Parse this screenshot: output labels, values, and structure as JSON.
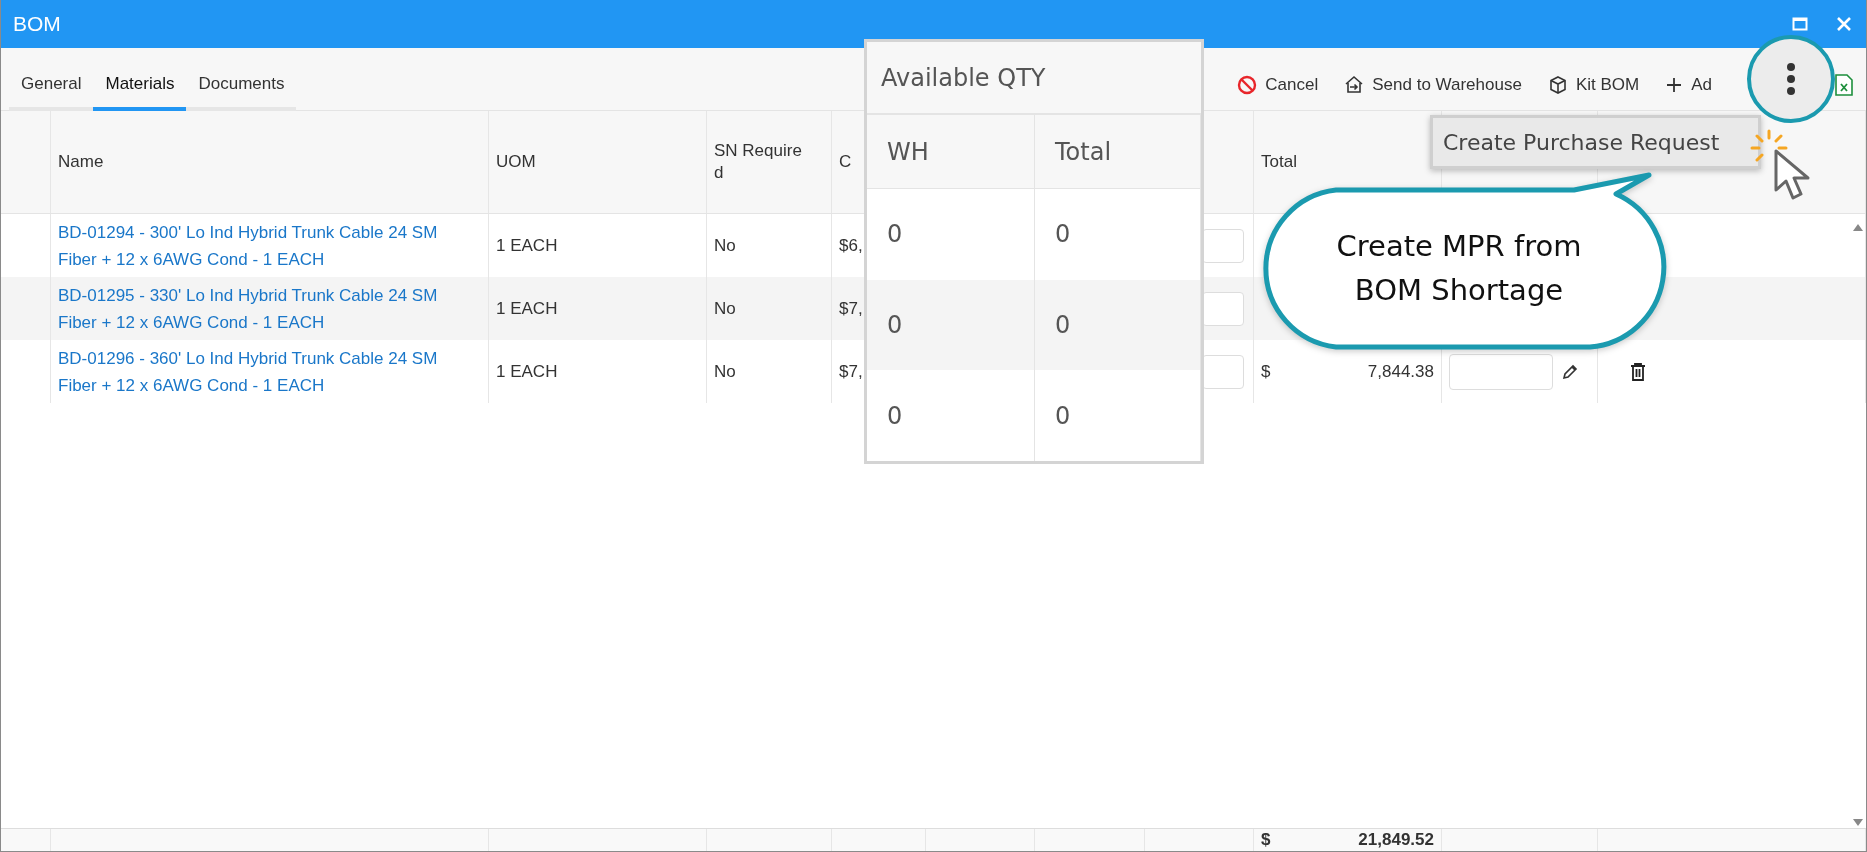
{
  "window": {
    "title": "BOM"
  },
  "tabs": [
    {
      "label": "General",
      "selected": false
    },
    {
      "label": "Materials",
      "selected": true
    },
    {
      "label": "Documents",
      "selected": false
    }
  ],
  "toolbar": [
    {
      "kind": "cancel",
      "label": "Cancel"
    },
    {
      "kind": "send",
      "label": "Send to Warehouse"
    },
    {
      "kind": "kit",
      "label": "Kit BOM"
    },
    {
      "kind": "add",
      "label": "Ad"
    }
  ],
  "table": {
    "columns": {
      "name": "Name",
      "uom": "UOM",
      "sn_required": "SN Required",
      "column_4": "C",
      "total": "Total"
    },
    "rows": [
      {
        "name": "BD-01294 - 300' Lo Ind Hybrid Trunk Cable 24 SM Fiber + 12 x 6AWG Cond - 1 EACH",
        "uom": "1 EACH",
        "sn_required": "No",
        "column_4": "$6,",
        "selected": false
      },
      {
        "name": "BD-01295 - 330' Lo Ind Hybrid Trunk Cable 24 SM Fiber + 12 x 6AWG Cond - 1 EACH",
        "uom": "1 EACH",
        "sn_required": "No",
        "column_4": "$7,",
        "selected": false
      },
      {
        "name": "BD-01296 - 360' Lo Ind Hybrid Trunk Cable 24 SM Fiber + 12 x 6AWG Cond - 1 EACH",
        "uom": "1 EACH",
        "sn_required": "No",
        "column_4": "$7,",
        "currency": "$",
        "total": "7,844.38",
        "selected": false
      }
    ],
    "footer": {
      "currency": "$",
      "total": "21,849.52"
    }
  },
  "qty_popup": {
    "title": "Available QTY",
    "columns": [
      "WH",
      "Total"
    ],
    "rows": [
      [
        "0",
        "0"
      ],
      [
        "0",
        "0"
      ],
      [
        "0",
        "0"
      ]
    ]
  },
  "menu": {
    "items": [
      "Create Purchase Request"
    ]
  },
  "callout": {
    "text": "Create MPR from BOM Shortage"
  }
}
